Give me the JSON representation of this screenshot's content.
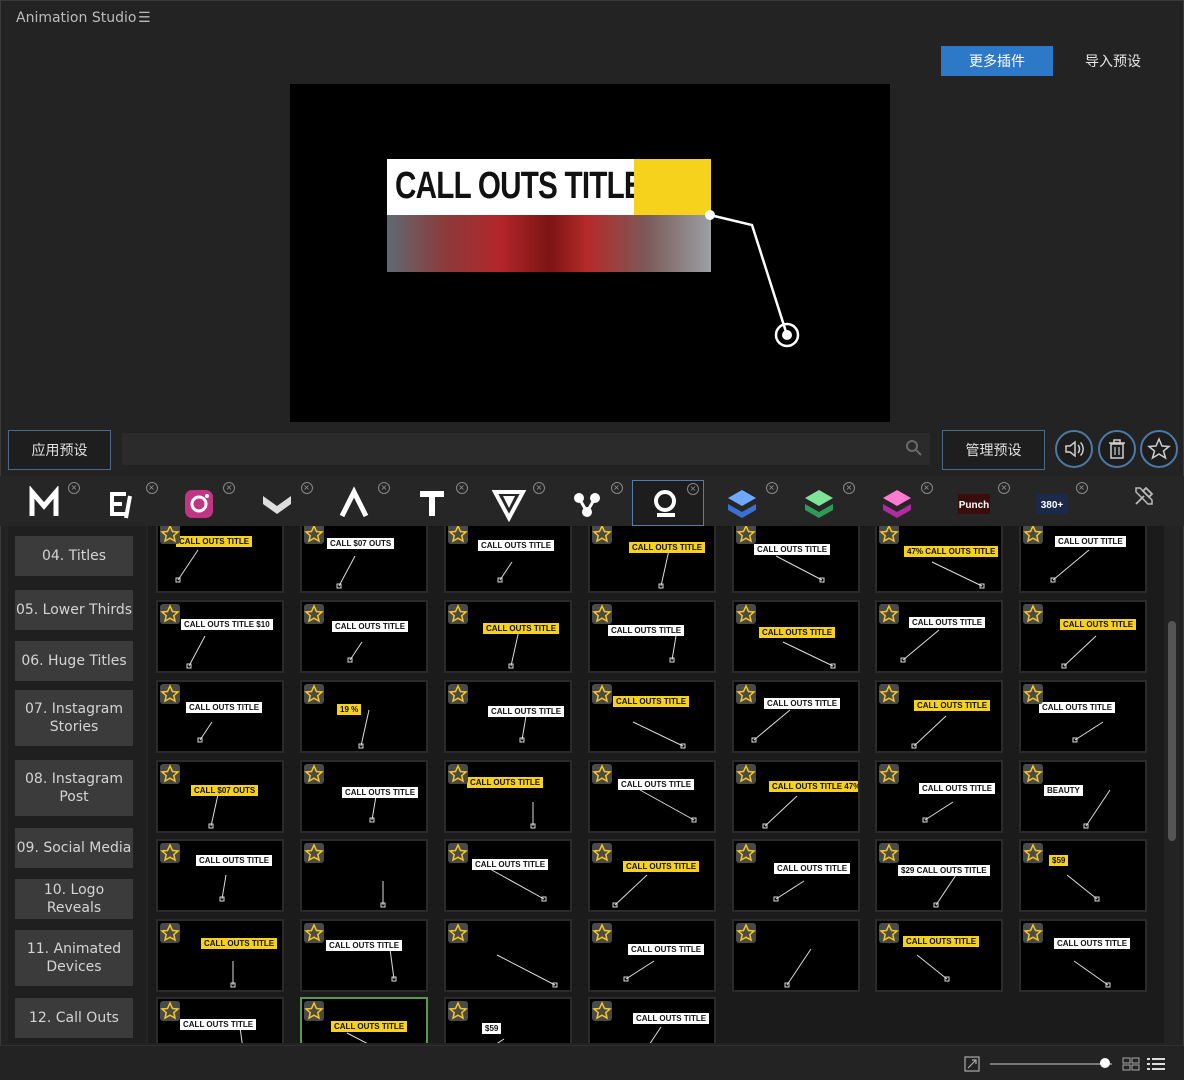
{
  "window": {
    "title": "Animation Studio",
    "menu_icon": "hamburger-icon"
  },
  "header": {
    "more_plugins_label": "更多插件",
    "import_preset_label": "导入预设",
    "accent": "#2d79c7"
  },
  "preview": {
    "title_text": "CALL OUTS TITLE",
    "highlight": "#f6d21c"
  },
  "toolbar": {
    "apply_label": "应用预设",
    "search_placeholder": "",
    "manage_label": "管理预设",
    "icons": [
      "speaker-icon",
      "trash-icon",
      "star-icon"
    ]
  },
  "plugins": [
    {
      "name": "M",
      "icon": "m-logo-icon"
    },
    {
      "name": "E7",
      "icon": "e7-logo-icon"
    },
    {
      "name": "Instagram",
      "icon": "instagram-logo-icon"
    },
    {
      "name": "Chevron",
      "icon": "chevron-badge-icon"
    },
    {
      "name": "A",
      "icon": "a-logo-icon"
    },
    {
      "name": "T",
      "icon": "t-logo-icon"
    },
    {
      "name": "V",
      "icon": "v-logo-icon"
    },
    {
      "name": "Molecule",
      "icon": "molecule-logo-icon"
    },
    {
      "name": "Callouts",
      "icon": "callout-logo-icon",
      "active": true
    },
    {
      "name": "Blue Stack",
      "icon": "blue-stack-icon"
    },
    {
      "name": "Green Stack",
      "icon": "green-stack-icon"
    },
    {
      "name": "Pink Stack",
      "icon": "pink-stack-icon"
    },
    {
      "name": "Punch",
      "icon": "punch-logo-icon",
      "label": "Punch"
    },
    {
      "name": "380+",
      "icon": "transitions-logo-icon",
      "label": "380+"
    }
  ],
  "categories": [
    "04. Titles",
    "05. Lower Thirds",
    "06. Huge Titles",
    "07. Instagram Stories",
    "08. Instagram Post",
    "09. Social Media",
    "10. Logo Reveals",
    "11. Animated Devices",
    "12. Call Outs"
  ],
  "presets": [
    [
      "CALL OUTS TITLE",
      "CALL $07 OUTS",
      "CALL OUTS TITLE",
      "CALL OUTS TITLE",
      "CALL OUTS TITLE",
      "47% CALL OUTS TITLE",
      "CALL OUT TITLE"
    ],
    [
      "CALL OUTS TITLE $10",
      "CALL OUTS TITLE",
      "CALL OUTS TITLE",
      "CALL OUTS TITLE",
      "CALL OUTS TITLE",
      "CALL OUTS TITLE",
      "CALL OUTS TITLE"
    ],
    [
      "CALL OUTS TITLE",
      "19 %",
      "CALL OUTS TITLE",
      "CALL OUTS TITLE",
      "CALL OUTS TITLE",
      "CALL OUTS TITLE",
      "CALL OUTS TITLE"
    ],
    [
      "CALL $07 OUTS",
      "CALL OUTS TITLE",
      "CALL OUTS TITLE",
      "CALL OUTS TITLE",
      "CALL OUTS TITLE 47%",
      "CALL OUTS TITLE",
      "BEAUTY"
    ],
    [
      "CALL OUTS TITLE",
      "",
      "CALL OUTS TITLE",
      "CALL OUTS TITLE",
      "CALL OUTS TITLE",
      "$29 CALL OUTS TITLE",
      "$59"
    ],
    [
      "CALL OUTS TITLE",
      "CALL OUTS TITLE",
      "",
      "CALL OUTS TITLE",
      "",
      "CALL OUTS TITLE",
      "CALL OUTS TITLE"
    ],
    [
      "CALL OUTS TITLE",
      "CALL OUTS TITLE",
      "$59",
      "CALL OUTS TITLE"
    ]
  ],
  "statusbar": {
    "zoom_level": 0.94,
    "icons": [
      "fit-icon",
      "grid-view-icon",
      "list-view-icon"
    ]
  }
}
